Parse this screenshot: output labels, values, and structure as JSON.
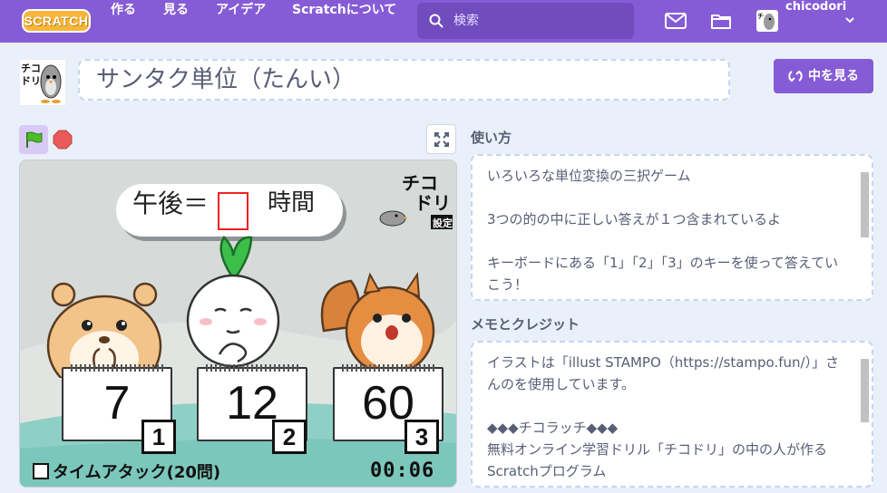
{
  "nav": {
    "logo": "SCRATCH",
    "links": [
      "作る",
      "見る",
      "アイデア",
      "Scratchについて"
    ],
    "search_placeholder": "検索",
    "username": "chicodori"
  },
  "project": {
    "title": "サンタク単位（たんい）",
    "see_inside": "中を見る"
  },
  "stage": {
    "question_left": "午後＝",
    "question_right": "時間",
    "logo_text": "チコドリ",
    "settings_label": "設定",
    "cards": [
      {
        "value": "7",
        "key": "1"
      },
      {
        "value": "12",
        "key": "2"
      },
      {
        "value": "60",
        "key": "3"
      }
    ],
    "time_attack": "タイムアタック(20問)",
    "timer": "00:06"
  },
  "instructions": {
    "title": "使い方",
    "lines": [
      "いろいろな単位変換の三択ゲーム",
      "",
      "3つの的の中に正しい答えが１つ含まれているよ",
      "",
      "キーボードにある「1」「2」「3」のキーを使って答えていこう！"
    ]
  },
  "notes": {
    "title": "メモとクレジット",
    "lines": [
      "イラストは「illust STAMPO（https://stampo.fun/）」さんのを使用しています。",
      "",
      "◆◆◆チコラッチ◆◆◆",
      "無料オンライン学習ドリル「チコドリ」の中の人が作るScratchプログラム"
    ]
  },
  "colors": {
    "nav_bg": "#855cd6",
    "accent": "#855cd6",
    "text": "#575e75",
    "page_bg": "#e9f0fa"
  }
}
